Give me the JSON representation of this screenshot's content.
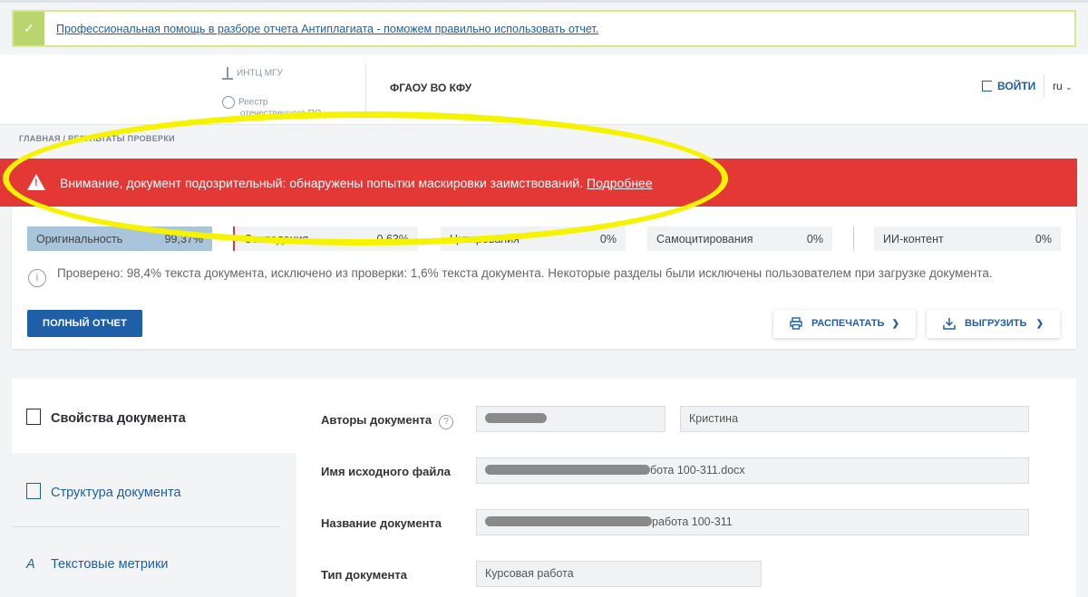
{
  "notice": {
    "text": "Профессиональная помощь в разборе отчета Антиплагиата - поможем правильно использовать отчет."
  },
  "header": {
    "logo_line1": "ИНТЦ МГУ",
    "logo_line2": "Реестр",
    "logo_line3": "отечественного ПО",
    "org": "ФГАОУ ВО КФУ",
    "login": "ВОЙТИ",
    "lang": "ru"
  },
  "breadcrumb": "ГЛАВНАЯ  /  РЕЗУЛЬТАТЫ ПРОВЕРКИ",
  "alert": {
    "text": "Внимание, документ подозрительный: обнаружены попытки маскировки заимствований.",
    "link": "Подробнее"
  },
  "metrics": {
    "originality": {
      "label": "Оригинальность",
      "value": "99,37%"
    },
    "matches": {
      "label": "Совпадения",
      "value": "0,63%"
    },
    "citations": {
      "label": "Цитирования",
      "value": "0%"
    },
    "self_citations": {
      "label": "Самоцитирования",
      "value": "0%"
    },
    "ai": {
      "label": "ИИ-контент",
      "value": "0%"
    }
  },
  "check_info": "Проверено: 98,4% текста документа, исключено из проверки: 1,6% текста документа. Некоторые разделы были исключены пользователем при загрузке документа.",
  "actions": {
    "full_report": "ПОЛНЫЙ ОТЧЕТ",
    "print": "РАСПЕЧАТАТЬ",
    "download": "ВЫГРУЗИТЬ"
  },
  "sidebar": {
    "properties": "Свойства документа",
    "structure": "Структура документа",
    "metrics": "Текстовые метрики"
  },
  "fields": {
    "authors_label": "Авторы документа",
    "author_name": "Кристина",
    "filename_label": "Имя исходного файла",
    "filename_value": "бота 100-311.docx",
    "title_label": "Название документа",
    "title_value": "работа 100-311",
    "type_label": "Тип документа",
    "type_value": "Курсовая работа"
  },
  "colors": {
    "alert": "#e33836",
    "accent": "#1f5fa8",
    "highlight_ellipse": "#f5f300",
    "originality_bg": "#a9c4db"
  }
}
